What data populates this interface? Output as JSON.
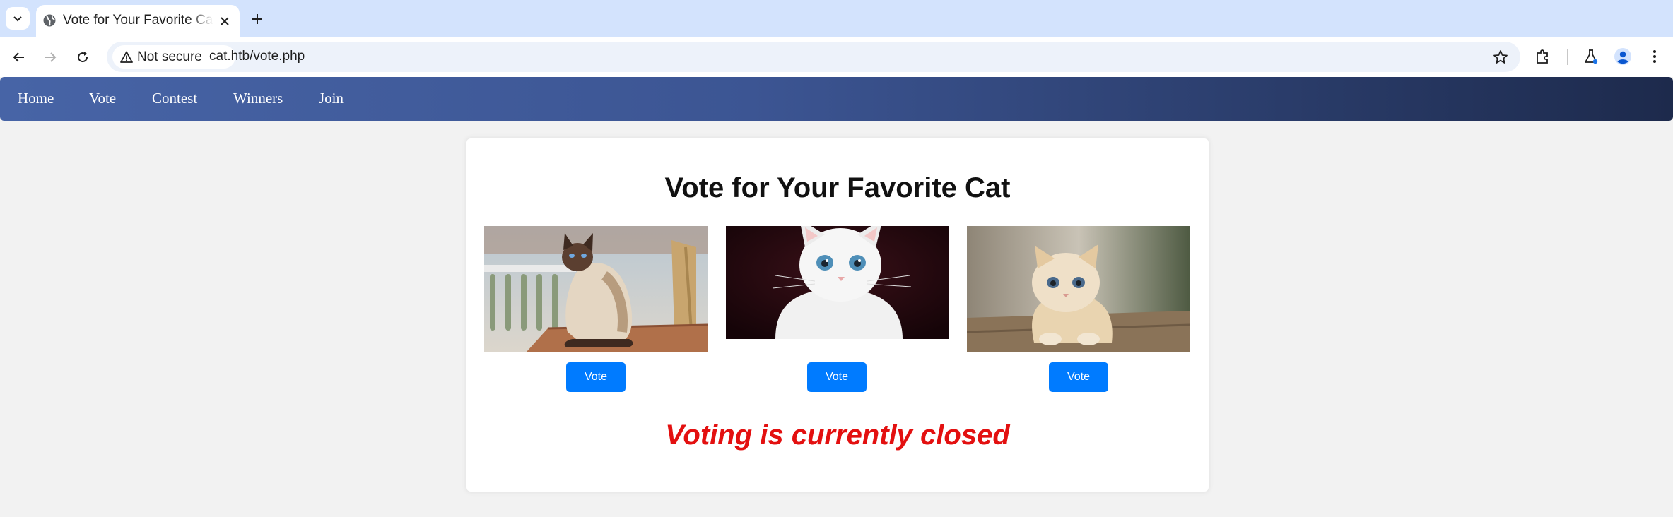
{
  "browser": {
    "tab": {
      "title": "Vote for Your Favorite Cat"
    },
    "address_bar": {
      "security_label": "Not secure",
      "url": "cat.htb/vote.php"
    }
  },
  "site": {
    "nav": {
      "items": [
        {
          "label": "Home"
        },
        {
          "label": "Vote"
        },
        {
          "label": "Contest"
        },
        {
          "label": "Winners"
        },
        {
          "label": "Join"
        }
      ]
    },
    "heading": "Vote for Your Favorite Cat",
    "candidates": [
      {
        "image": "siamese-cat-photo",
        "button_label": "Vote"
      },
      {
        "image": "white-kitten-photo",
        "button_label": "Vote"
      },
      {
        "image": "fluffy-kitten-photo",
        "button_label": "Vote"
      }
    ],
    "status_message": "Voting is currently closed"
  },
  "colors": {
    "vote_button": "#007bff",
    "status_message": "#e31010",
    "nav_gradient_start": "#4764a6",
    "nav_gradient_end": "#1d2a4c"
  }
}
